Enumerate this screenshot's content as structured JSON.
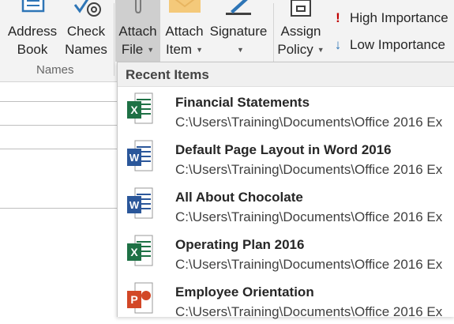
{
  "ribbon": {
    "address_book": {
      "line1": "Address",
      "line2": "Book"
    },
    "check_names": {
      "line1": "Check",
      "line2": "Names"
    },
    "names_group_label": "Names",
    "attach_file": {
      "line1": "Attach",
      "line2": "File"
    },
    "attach_item": {
      "line1": "Attach",
      "line2": "Item"
    },
    "signature": {
      "line1": "Signature"
    },
    "assign_policy": {
      "line1": "Assign",
      "line2": "Policy"
    },
    "high_importance": "High Importance",
    "low_importance": "Low Importance"
  },
  "dropdown": {
    "header": "Recent Items",
    "items": [
      {
        "title": "Financial Statements",
        "path": "C:\\Users\\Training\\Documents\\Office 2016 Ex",
        "icon": "excel-icon"
      },
      {
        "title": "Default Page Layout in Word 2016",
        "path": "C:\\Users\\Training\\Documents\\Office 2016 Ex",
        "icon": "word-icon"
      },
      {
        "title": "All About Chocolate",
        "path": "C:\\Users\\Training\\Documents\\Office 2016 Ex",
        "icon": "word-icon"
      },
      {
        "title": "Operating Plan 2016",
        "path": "C:\\Users\\Training\\Documents\\Office 2016 Ex",
        "icon": "excel-icon"
      },
      {
        "title": "Employee Orientation",
        "path": "C:\\Users\\Training\\Documents\\Office 2016 Ex",
        "icon": "powerpoint-icon"
      }
    ]
  },
  "colors": {
    "excel": "#1e7145",
    "word": "#2b579a",
    "powerpoint": "#d24726",
    "high_importance": "#c00000",
    "low_importance": "#2e75b6"
  }
}
